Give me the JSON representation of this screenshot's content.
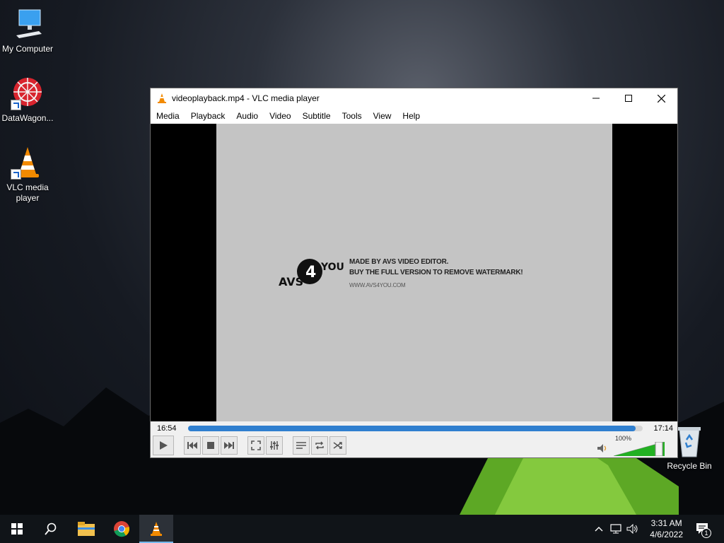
{
  "desktop": {
    "icons": [
      {
        "label": "My Computer",
        "icon": "computer-icon"
      },
      {
        "label": "DataWagon...",
        "icon": "datawagon-icon"
      },
      {
        "label": "VLC media player",
        "icon": "vlc-cone-icon"
      },
      {
        "label": "Recycle Bin",
        "icon": "recycle-bin-icon"
      }
    ]
  },
  "vlc": {
    "title": "videoplayback.mp4 - VLC media player",
    "menu": [
      "Media",
      "Playback",
      "Audio",
      "Video",
      "Subtitle",
      "Tools",
      "View",
      "Help"
    ],
    "video": {
      "watermark_logo_text": "AVS4YOU",
      "watermark_line1": "MADE BY AVS VIDEO EDITOR.",
      "watermark_line2": "BUY THE FULL VERSION TO REMOVE WATERMARK!",
      "watermark_url": "WWW.AVS4YOU.COM"
    },
    "time_elapsed": "16:54",
    "time_total": "17:14",
    "progress": 0.985,
    "volume": {
      "label": "100%",
      "level": 1.0
    },
    "controls": [
      "play-button",
      "previous-button",
      "stop-button",
      "next-button",
      "fullscreen-button",
      "extended-settings-button",
      "playlist-button",
      "loop-button",
      "shuffle-button"
    ],
    "colors": {
      "progress": "#2f7fcf",
      "volume": "#22b022"
    }
  },
  "taskbar": {
    "apps": [
      "file-explorer-icon",
      "chrome-icon",
      "vlc-cone-icon"
    ],
    "clock_time": "3:31 AM",
    "clock_date": "4/6/2022",
    "notification_count": "1"
  }
}
